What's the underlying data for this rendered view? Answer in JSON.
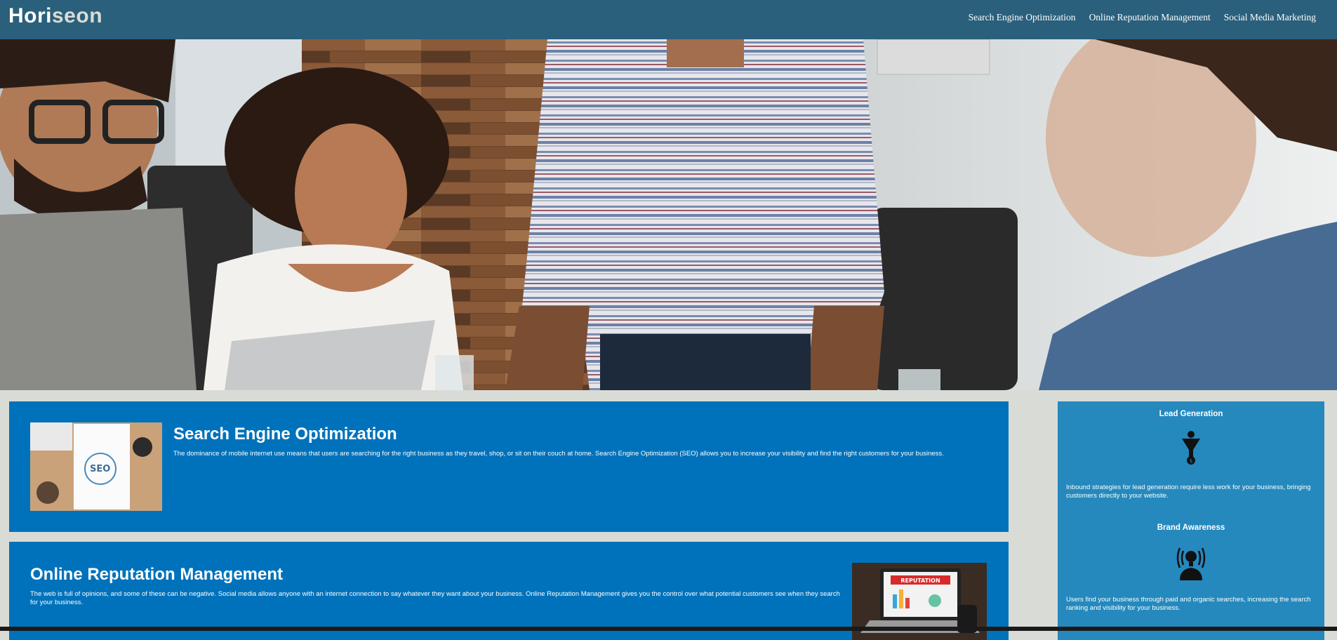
{
  "header": {
    "logo_main": "Hori",
    "logo_accent": "seon",
    "nav": [
      {
        "label": "Search Engine Optimization"
      },
      {
        "label": "Online Reputation Management"
      },
      {
        "label": "Social Media Marketing"
      }
    ]
  },
  "content": {
    "seo": {
      "title": "Search Engine Optimization",
      "text": "The dominance of mobile internet use means that users are searching for the right business as they travel, shop, or sit on their couch at home. Search Engine Optimization (SEO) allows you to increase your visibility and find the right customers for your business."
    },
    "orm": {
      "title": "Online Reputation Management",
      "text": "The web is full of opinions, and some of these can be negative. Social media allows anyone with an internet connection to say whatever they want about your business. Online Reputation Management gives you the control over what potential customers see when they search for your business.",
      "image_label": "REPUTATION"
    }
  },
  "sidebar": {
    "lead": {
      "title": "Lead Generation",
      "text": "Inbound strategies for lead generation require less work for your business, bringing customers directly to your website."
    },
    "brand": {
      "title": "Brand Awareness",
      "text": "Users find your business through paid and organic searches, increasing the search ranking and visibility for your business."
    }
  },
  "colors": {
    "header_bg": "#2a607c",
    "card_bg": "#0072bb",
    "sidebar_bg": "#2589bd",
    "page_bg": "#d9dcd6"
  },
  "icons": [
    "lead-funnel-icon",
    "brand-lightbulb-icon"
  ]
}
